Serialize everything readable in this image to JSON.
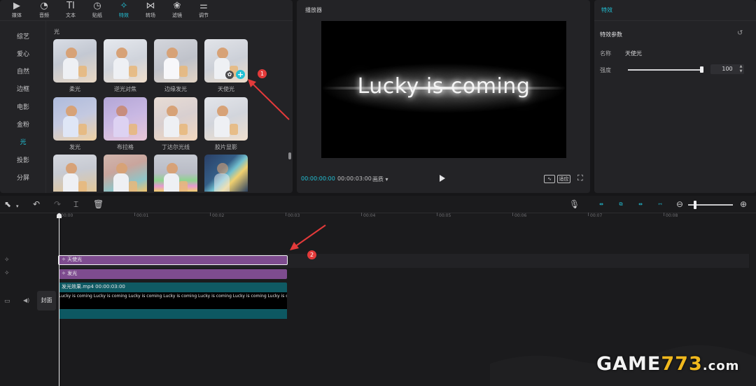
{
  "top_tabs": [
    {
      "label": "媒体",
      "icon": "media-icon"
    },
    {
      "label": "音频",
      "icon": "audio-icon"
    },
    {
      "label": "文本",
      "icon": "text-icon"
    },
    {
      "label": "贴纸",
      "icon": "sticker-icon"
    },
    {
      "label": "特效",
      "icon": "effects-icon",
      "active": true
    },
    {
      "label": "转场",
      "icon": "transition-icon"
    },
    {
      "label": "滤镜",
      "icon": "filter-icon"
    },
    {
      "label": "调节",
      "icon": "adjust-icon"
    }
  ],
  "categories": [
    "综艺",
    "爱心",
    "自然",
    "边框",
    "电影",
    "金粉",
    "光",
    "投影",
    "分屏"
  ],
  "active_category": "光",
  "section_title": "光",
  "effects": [
    {
      "label": "柔光"
    },
    {
      "label": "逆光对焦"
    },
    {
      "label": "边缘发光"
    },
    {
      "label": "天使光"
    },
    {
      "label": "发光"
    },
    {
      "label": "布拉格"
    },
    {
      "label": "丁达尔光线"
    },
    {
      "label": "胶片显影"
    },
    {
      "label": ""
    },
    {
      "label": ""
    },
    {
      "label": ""
    },
    {
      "label": ""
    }
  ],
  "markers": [
    "1",
    "2"
  ],
  "player": {
    "title": "播放器",
    "overlay_text": "Lucky is coming",
    "current_time": "00:00:00:00",
    "total_time": "00:00:03:00",
    "ratio_label": "画质",
    "original_btn": "原",
    "fit_btn": "适应"
  },
  "props": {
    "header": "特效",
    "section": "特效参数",
    "name_label": "名称",
    "name_value": "天使光",
    "strength_label": "强度",
    "strength_value": "100",
    "strength_fraction": 1.0
  },
  "ruler": [
    "00:00",
    "00:01",
    "00:02",
    "00:03",
    "00:04",
    "00:05",
    "00:06",
    "00:07",
    "00:08"
  ],
  "tracks": {
    "fx1_label": "天使光",
    "fx2_label": "发光",
    "video_title": "发光效果.mp4   00:00:03:00",
    "video_strip_text": "Lucky is coming  Lucky is coming  Lucky is coming  Lucky is coming  Lucky is coming  Lucky is coming  Lucky is coming  Lucky is coming  Lucky is coming",
    "cover_label": "封面"
  },
  "watermark": {
    "part1": "GAME",
    "part2": "773",
    "part3": ".com"
  },
  "colors": {
    "accent": "#22c1d6",
    "effect_clip": "#7e4c8f",
    "video_clip": "#0f5a63",
    "marker": "#e33a3a"
  }
}
